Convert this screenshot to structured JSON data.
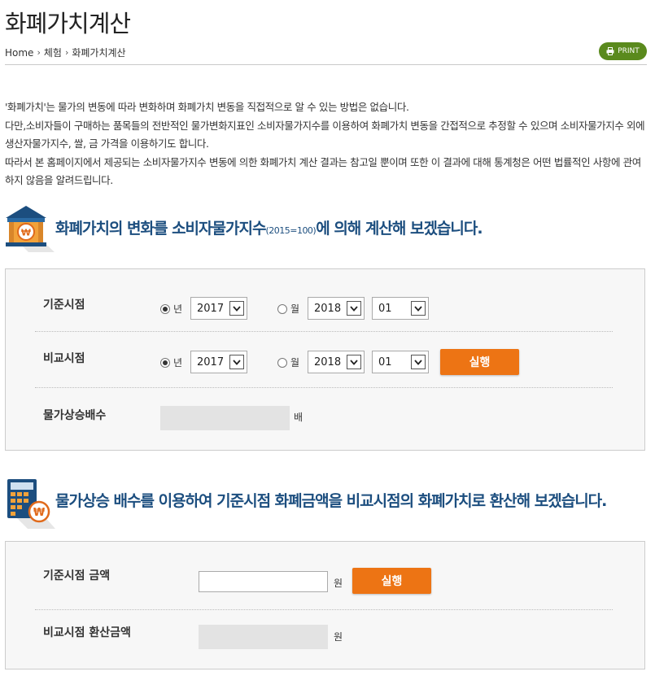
{
  "header": {
    "title": "화폐가치계산",
    "breadcrumb": [
      "Home",
      "체험",
      "화폐가치계산"
    ],
    "print_label": "PRINT"
  },
  "notice": [
    "'화폐가치'는 물가의 변동에 따라 변화하며 화폐가치 변동을 직접적으로 알 수 있는 방법은 없습니다.",
    "다만,소비자들이 구매하는 품목들의 전반적인 물가변화지표인 소비자물가지수를 이용하여 화폐가치 변동을 간접적으로 추정할 수 있으며 소비자물가지수 외에 생산자물가지수, 쌀, 금 가격을 이용하기도 합니다.",
    "따라서 본 홈페이지에서 제공되는 소비자물가지수 변동에 의한 화폐가치 계산 결과는 참고일 뿐이며 또한 이 결과에 대해 통계청은 어떤 법률적인 사항에 관여하지 않음을 알려드립니다."
  ],
  "section1": {
    "title_main": "화폐가치의 변화를 소비자물가지수",
    "title_small": "(2015=100)",
    "title_tail": "에 의해 계산해 보겠습니다.",
    "icon": "bank-coin-icon",
    "base": {
      "label": "기준시점",
      "year_radio_label": "년",
      "year_radio_selected": true,
      "year_value": "2017",
      "month_radio_label": "월",
      "month_radio_selected": false,
      "month_year_value": "2018",
      "month_value": "01"
    },
    "compare": {
      "label": "비교시점",
      "year_radio_label": "년",
      "year_radio_selected": true,
      "year_value": "2017",
      "month_radio_label": "월",
      "month_radio_selected": false,
      "month_year_value": "2018",
      "month_value": "01"
    },
    "run_label": "실행",
    "result": {
      "label": "물가상승배수",
      "value": "",
      "unit": "배"
    }
  },
  "section2": {
    "title": "물가상승 배수를 이용하여 기준시점 화폐금액을 비교시점의 화폐가치로 환산해 보겠습니다.",
    "icon": "calculator-coin-icon",
    "base_amount": {
      "label": "기준시점 금액",
      "value": "",
      "unit": "원"
    },
    "run_label": "실행",
    "converted": {
      "label": "비교시점 환산금액",
      "value": "",
      "unit": "원"
    }
  },
  "colors": {
    "accent_orange": "#ed7414",
    "title_blue": "#1c4e7f",
    "print_green": "#5a8a1d"
  }
}
